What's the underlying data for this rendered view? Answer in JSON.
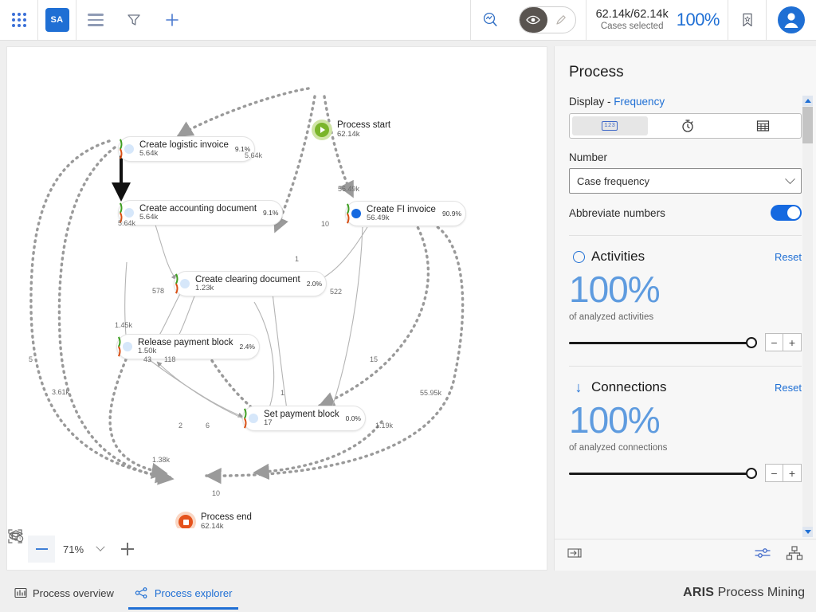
{
  "topbar": {
    "apps_icon": "app-grid-icon",
    "workspace_badge": "SA",
    "menu_icon": "hamburger-icon",
    "filter_icon": "funnel-icon",
    "add_icon": "plus-icon",
    "analysis_icon": "analysis-search-icon",
    "view_mode_eye_icon": "eye-icon",
    "view_mode_pen_icon": "pencil-icon",
    "cases_value": "62.14k/62.14k",
    "cases_label": "Cases selected",
    "cases_percent": "100%",
    "bookmark_icon": "bookmark-star-icon",
    "avatar_icon": "user-avatar-icon"
  },
  "canvas": {
    "zoom_level": "71%",
    "minus_icon": "zoom-out-icon",
    "plus_icon": "zoom-in-icon",
    "fit_icon": "fit-to-screen-icon",
    "layers_icon": "layers-icon",
    "legend_icon": "legend-icon"
  },
  "diagram": {
    "nodes": [
      {
        "id": "start",
        "type": "start",
        "label": "Process start",
        "count": "62.14k"
      },
      {
        "id": "logistic",
        "type": "activity",
        "label": "Create logistic invoice",
        "count": "5.64k",
        "pct": "9.1%",
        "dot": "light"
      },
      {
        "id": "accounting",
        "type": "activity",
        "label": "Create accounting document",
        "count": "5.64k",
        "pct": "9.1%",
        "dot": "light"
      },
      {
        "id": "fi",
        "type": "activity",
        "label": "Create FI invoice",
        "count": "56.49k",
        "pct": "90.9%",
        "dot": "solid"
      },
      {
        "id": "clearing",
        "type": "activity",
        "label": "Create clearing document",
        "count": "1.23k",
        "pct": "2.0%",
        "dot": "light"
      },
      {
        "id": "release",
        "type": "activity",
        "label": "Release payment block",
        "count": "1.50k",
        "pct": "2.4%",
        "dot": "light"
      },
      {
        "id": "setblock",
        "type": "activity",
        "label": "Set payment block",
        "count": "17",
        "pct": "0.0%",
        "dot": "light"
      },
      {
        "id": "end",
        "type": "end",
        "label": "Process end",
        "count": "62.14k"
      }
    ],
    "edge_labels": [
      {
        "id": "e1",
        "value": "5.64k"
      },
      {
        "id": "e2",
        "value": "56.49k"
      },
      {
        "id": "e3",
        "value": "10"
      },
      {
        "id": "e4",
        "value": "5.64k"
      },
      {
        "id": "e5",
        "value": "1"
      },
      {
        "id": "e6",
        "value": "578"
      },
      {
        "id": "e7",
        "value": "522"
      },
      {
        "id": "e8",
        "value": "1.45k"
      },
      {
        "id": "e9",
        "value": "43"
      },
      {
        "id": "e10",
        "value": "118"
      },
      {
        "id": "e11",
        "value": "15"
      },
      {
        "id": "e12",
        "value": "5"
      },
      {
        "id": "e13",
        "value": "3.61k"
      },
      {
        "id": "e14",
        "value": "55.95k"
      },
      {
        "id": "e15",
        "value": "1"
      },
      {
        "id": "e16",
        "value": "2"
      },
      {
        "id": "e17",
        "value": "6"
      },
      {
        "id": "e18",
        "value": "1.19k"
      },
      {
        "id": "e19",
        "value": "1.38k"
      },
      {
        "id": "e20",
        "value": "10"
      }
    ]
  },
  "panel": {
    "title": "Process",
    "display_label": "Display -",
    "display_value": "Frequency",
    "segmented": [
      {
        "icon": "numbers-123-icon",
        "name": "frequency-mode",
        "active": true
      },
      {
        "icon": "stopwatch-icon",
        "name": "duration-mode",
        "active": false
      },
      {
        "icon": "table-grid-icon",
        "name": "table-mode",
        "active": false
      }
    ],
    "number_label": "Number",
    "number_value": "Case frequency",
    "abbreviate_label": "Abbreviate numbers",
    "abbreviate_on": true,
    "sections": [
      {
        "icon": "circle-outline-icon",
        "title": "Activities",
        "reset": "Reset",
        "percent": "100%",
        "caption": "of analyzed activities",
        "minus": "−",
        "plus": "+"
      },
      {
        "icon": "down-arrow-icon",
        "title": "Connections",
        "reset": "Reset",
        "percent": "100%",
        "caption": "of analyzed connections",
        "minus": "−",
        "plus": "+"
      }
    ],
    "footer": {
      "collapse_icon": "collapse-panel-icon",
      "settings_icon": "sliders-settings-icon",
      "hierarchy_icon": "org-hierarchy-icon"
    }
  },
  "bottombar": {
    "tabs": [
      {
        "icon": "process-overview-icon",
        "label": "Process overview",
        "active": false
      },
      {
        "icon": "process-explorer-icon",
        "label": "Process explorer",
        "active": true
      }
    ],
    "brand_bold": "ARIS",
    "brand_rest": "Process Mining"
  },
  "colors": {
    "accent": "#1f6fd4",
    "start_node": "#7ab52a",
    "end_node": "#e5521c",
    "percent_big": "#5e9bdf"
  }
}
